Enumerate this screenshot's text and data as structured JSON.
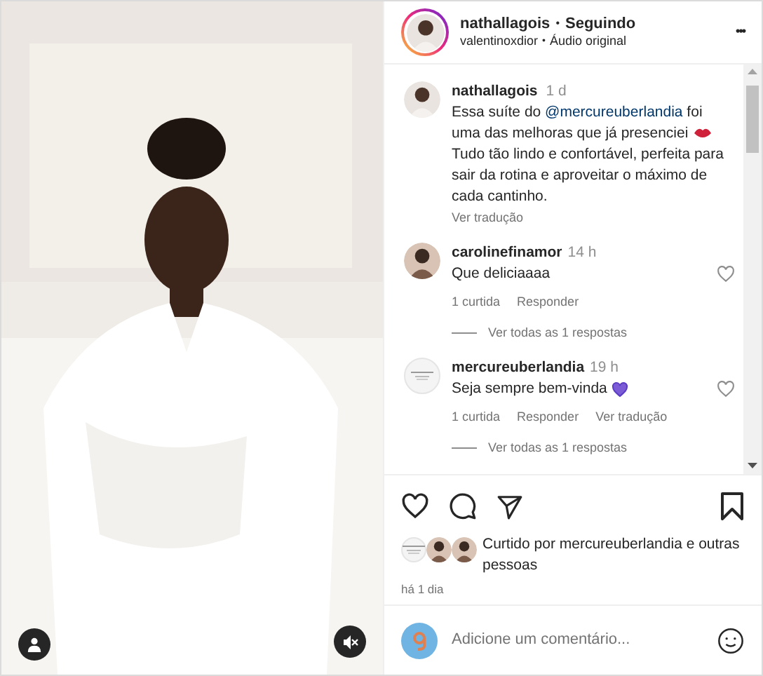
{
  "post": {
    "username": "nathallagois",
    "separator": "•",
    "follow_status": "Seguindo",
    "audio_author": "valentinoxdior",
    "audio_title": "Áudio original",
    "more": "•••"
  },
  "caption": {
    "username": "nathallagois",
    "time": "1 d",
    "before": "Essa suíte do ",
    "mention": "@mercureuberlandia",
    "middle": " foi uma das melhoras que já presenciei ",
    "after": " Tudo tão lindo e confortável, perfeita para sair da rotina e aproveitar o máximo de cada cantinho.",
    "translate": "Ver tradução"
  },
  "comments": [
    {
      "username": "carolinefinamor",
      "time": "14 h",
      "text": "Que deliciaaaa",
      "emoji": false,
      "likes": "1 curtida",
      "reply": "Responder",
      "replies": "Ver todas as 1 respostas",
      "liked": false
    },
    {
      "username": "mercureuberlandia",
      "time": "19 h",
      "text": "Seja sempre bem-vinda",
      "emoji": true,
      "likes": "1 curtida",
      "reply": "Responder",
      "translate": "Ver tradução",
      "replies": "Ver todas as 1 respostas",
      "kind": "logo",
      "liked": false
    }
  ],
  "actions": {
    "liked": false,
    "saved": false
  },
  "likes": {
    "text": "Curtido por mercureuberlandia e outras pessoas"
  },
  "timestamp": "há 1 dia",
  "comment_input": {
    "placeholder": "Adicione um comentário..."
  }
}
